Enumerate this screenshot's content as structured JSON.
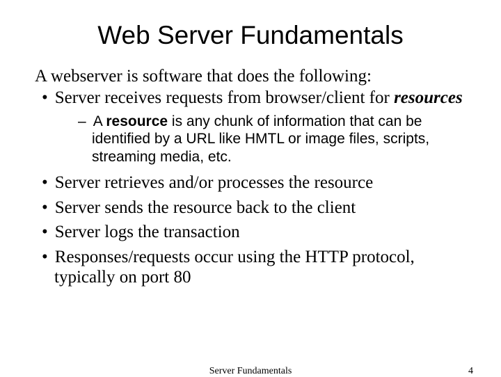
{
  "title": "Web Server Fundamentals",
  "intro": "A webserver is software that does the following:",
  "bullet1_a": "Server receives requests from browser/client for ",
  "bullet1_b": "resources",
  "sub_a": "A ",
  "sub_b": "resource",
  "sub_c": " is any chunk of information that can be identified by a URL like HMTL or image files, scripts, streaming media, etc.",
  "bullet2": "Server retrieves and/or processes the resource",
  "bullet3": "Server sends the resource back to the client",
  "bullet4": "Server logs the transaction",
  "bullet5": "Responses/requests occur using the HTTP protocol, typically on port 80",
  "footer_center": "Server Fundamentals",
  "footer_right": "4"
}
